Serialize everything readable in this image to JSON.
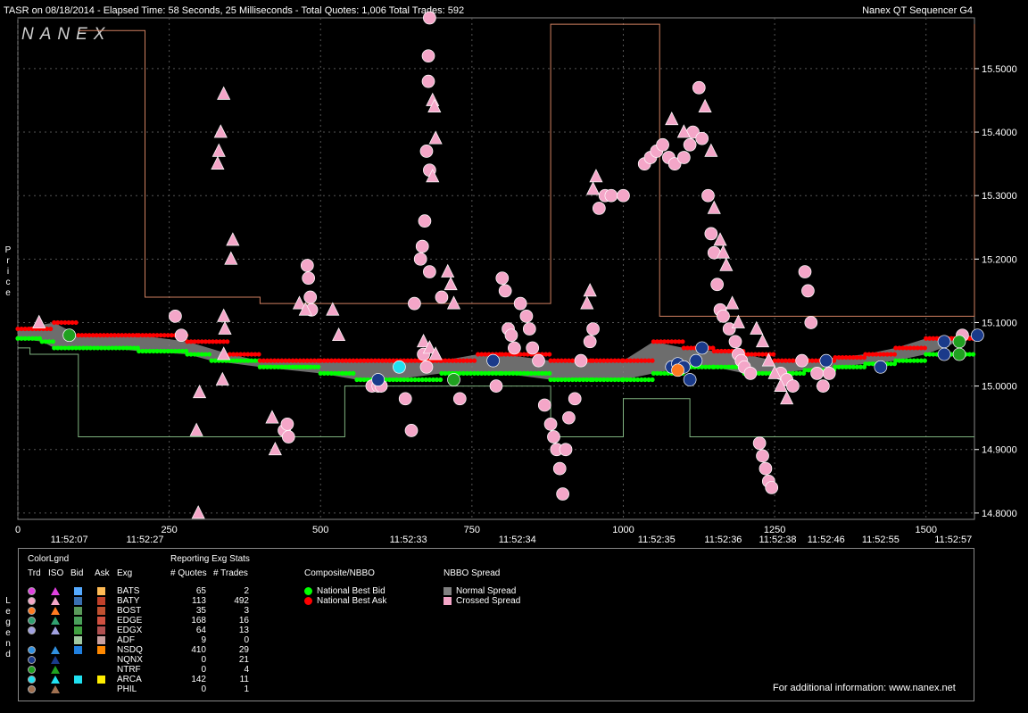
{
  "header": {
    "title": "TASR on 08/18/2014  -  Elapsed Time: 58 Seconds, 25 Milliseconds  -  Total Quotes: 1,006  Total Trades: 592",
    "app_name": "Nanex QT Sequencer G4"
  },
  "watermark": "NANEX",
  "side_labels": {
    "price": [
      "P",
      "r",
      "i",
      "c",
      "e"
    ],
    "legend": [
      "L",
      "e",
      "g",
      "e",
      "n",
      "d"
    ]
  },
  "chart_data": {
    "type": "scatter",
    "title": "TASR on 08/18/2014",
    "xlabel": "",
    "ylabel": "Price",
    "xlim": [
      0,
      1580
    ],
    "ylim": [
      14.79,
      15.58
    ],
    "x_ticks": [
      0,
      250,
      500,
      750,
      1000,
      1250,
      1500
    ],
    "y_ticks": [
      14.8,
      14.9,
      15.0,
      15.1,
      15.2,
      15.3,
      15.4,
      15.5
    ],
    "y_tick_labels": [
      "14.8000",
      "14.9000",
      "15.0000",
      "15.1000",
      "15.2000",
      "15.3000",
      "15.4000",
      "15.5000"
    ],
    "time_labels": [
      {
        "x": 85,
        "label": "11:52:07"
      },
      {
        "x": 210,
        "label": "11:52:27"
      },
      {
        "x": 645,
        "label": "11:52:33"
      },
      {
        "x": 825,
        "label": "11:52:34"
      },
      {
        "x": 1055,
        "label": "11:52:35"
      },
      {
        "x": 1165,
        "label": "11:52:36"
      },
      {
        "x": 1255,
        "label": "11:52:38"
      },
      {
        "x": 1335,
        "label": "11:52:46"
      },
      {
        "x": 1425,
        "label": "11:52:55"
      },
      {
        "x": 1545,
        "label": "11:52:57"
      }
    ],
    "grid": true,
    "nbbo_bid": [
      [
        0,
        15.075
      ],
      [
        40,
        15.07
      ],
      [
        60,
        15.06
      ],
      [
        150,
        15.06
      ],
      [
        200,
        15.055
      ],
      [
        280,
        15.05
      ],
      [
        320,
        15.04
      ],
      [
        400,
        15.03
      ],
      [
        500,
        15.02
      ],
      [
        560,
        15.01
      ],
      [
        620,
        15.01
      ],
      [
        700,
        15.02
      ],
      [
        760,
        15.02
      ],
      [
        800,
        15.02
      ],
      [
        880,
        15.01
      ],
      [
        950,
        15.01
      ],
      [
        1000,
        15.01
      ],
      [
        1050,
        15.02
      ],
      [
        1100,
        15.03
      ],
      [
        1150,
        15.03
      ],
      [
        1200,
        15.02
      ],
      [
        1250,
        15.02
      ],
      [
        1300,
        15.025
      ],
      [
        1350,
        15.03
      ],
      [
        1400,
        15.035
      ],
      [
        1450,
        15.04
      ],
      [
        1500,
        15.05
      ],
      [
        1580,
        15.05
      ]
    ],
    "nbbo_ask": [
      [
        0,
        15.09
      ],
      [
        60,
        15.1
      ],
      [
        100,
        15.08
      ],
      [
        200,
        15.08
      ],
      [
        280,
        15.07
      ],
      [
        350,
        15.05
      ],
      [
        400,
        15.04
      ],
      [
        500,
        15.04
      ],
      [
        560,
        15.04
      ],
      [
        620,
        15.04
      ],
      [
        700,
        15.04
      ],
      [
        760,
        15.05
      ],
      [
        800,
        15.05
      ],
      [
        880,
        15.04
      ],
      [
        950,
        15.04
      ],
      [
        1000,
        15.04
      ],
      [
        1050,
        15.07
      ],
      [
        1100,
        15.06
      ],
      [
        1150,
        15.055
      ],
      [
        1200,
        15.05
      ],
      [
        1250,
        15.04
      ],
      [
        1300,
        15.04
      ],
      [
        1350,
        15.045
      ],
      [
        1400,
        15.05
      ],
      [
        1450,
        15.06
      ],
      [
        1500,
        15.075
      ],
      [
        1580,
        15.08
      ]
    ],
    "trades_pink_circles": [
      [
        85,
        15.08
      ],
      [
        260,
        15.11
      ],
      [
        270,
        15.08
      ],
      [
        478,
        15.19
      ],
      [
        480,
        15.17
      ],
      [
        483,
        15.14
      ],
      [
        485,
        15.12
      ],
      [
        440,
        14.93
      ],
      [
        445,
        14.94
      ],
      [
        447,
        14.92
      ],
      [
        585,
        15.0
      ],
      [
        595,
        15.0
      ],
      [
        600,
        15.0
      ],
      [
        640,
        14.98
      ],
      [
        650,
        14.93
      ],
      [
        655,
        15.13
      ],
      [
        680,
        15.58
      ],
      [
        678,
        15.52
      ],
      [
        678,
        15.48
      ],
      [
        675,
        15.37
      ],
      [
        680,
        15.34
      ],
      [
        672,
        15.26
      ],
      [
        668,
        15.22
      ],
      [
        665,
        15.2
      ],
      [
        680,
        15.18
      ],
      [
        670,
        15.05
      ],
      [
        675,
        15.03
      ],
      [
        700,
        15.14
      ],
      [
        730,
        14.98
      ],
      [
        790,
        15.0
      ],
      [
        800,
        15.17
      ],
      [
        805,
        15.15
      ],
      [
        810,
        15.09
      ],
      [
        815,
        15.08
      ],
      [
        820,
        15.06
      ],
      [
        830,
        15.13
      ],
      [
        840,
        15.11
      ],
      [
        845,
        15.09
      ],
      [
        850,
        15.06
      ],
      [
        860,
        15.04
      ],
      [
        870,
        14.97
      ],
      [
        880,
        14.94
      ],
      [
        885,
        14.92
      ],
      [
        890,
        14.9
      ],
      [
        895,
        14.87
      ],
      [
        900,
        14.83
      ],
      [
        905,
        14.9
      ],
      [
        910,
        14.95
      ],
      [
        920,
        14.98
      ],
      [
        930,
        15.04
      ],
      [
        945,
        15.07
      ],
      [
        950,
        15.09
      ],
      [
        960,
        15.28
      ],
      [
        970,
        15.3
      ],
      [
        980,
        15.3
      ],
      [
        1000,
        15.3
      ],
      [
        1035,
        15.35
      ],
      [
        1045,
        15.36
      ],
      [
        1055,
        15.37
      ],
      [
        1065,
        15.38
      ],
      [
        1075,
        15.36
      ],
      [
        1085,
        15.35
      ],
      [
        1100,
        15.36
      ],
      [
        1110,
        15.38
      ],
      [
        1115,
        15.4
      ],
      [
        1125,
        15.47
      ],
      [
        1130,
        15.39
      ],
      [
        1140,
        15.3
      ],
      [
        1145,
        15.24
      ],
      [
        1150,
        15.21
      ],
      [
        1155,
        15.16
      ],
      [
        1160,
        15.12
      ],
      [
        1165,
        15.11
      ],
      [
        1175,
        15.09
      ],
      [
        1185,
        15.07
      ],
      [
        1190,
        15.05
      ],
      [
        1195,
        15.04
      ],
      [
        1200,
        15.03
      ],
      [
        1210,
        15.02
      ],
      [
        1225,
        14.91
      ],
      [
        1230,
        14.89
      ],
      [
        1235,
        14.87
      ],
      [
        1240,
        14.85
      ],
      [
        1245,
        14.84
      ],
      [
        1260,
        15.02
      ],
      [
        1270,
        15.01
      ],
      [
        1280,
        15.0
      ],
      [
        1295,
        15.04
      ],
      [
        1300,
        15.18
      ],
      [
        1305,
        15.15
      ],
      [
        1310,
        15.1
      ],
      [
        1320,
        15.02
      ],
      [
        1330,
        15.0
      ],
      [
        1340,
        15.02
      ],
      [
        1560,
        15.08
      ]
    ],
    "trades_pink_triangles": [
      [
        35,
        15.1
      ],
      [
        340,
        15.46
      ],
      [
        335,
        15.4
      ],
      [
        332,
        15.37
      ],
      [
        330,
        15.35
      ],
      [
        355,
        15.23
      ],
      [
        352,
        15.2
      ],
      [
        340,
        15.11
      ],
      [
        342,
        15.09
      ],
      [
        340,
        15.05
      ],
      [
        338,
        15.01
      ],
      [
        300,
        14.99
      ],
      [
        295,
        14.93
      ],
      [
        298,
        14.8
      ],
      [
        420,
        14.95
      ],
      [
        425,
        14.9
      ],
      [
        465,
        15.13
      ],
      [
        475,
        15.12
      ],
      [
        520,
        15.12
      ],
      [
        530,
        15.08
      ],
      [
        670,
        15.07
      ],
      [
        680,
        15.06
      ],
      [
        690,
        15.05
      ],
      [
        710,
        15.18
      ],
      [
        715,
        15.16
      ],
      [
        720,
        15.13
      ],
      [
        685,
        15.45
      ],
      [
        688,
        15.44
      ],
      [
        690,
        15.39
      ],
      [
        685,
        15.33
      ],
      [
        955,
        15.33
      ],
      [
        950,
        15.31
      ],
      [
        945,
        15.15
      ],
      [
        940,
        15.13
      ],
      [
        1080,
        15.42
      ],
      [
        1100,
        15.4
      ],
      [
        1135,
        15.44
      ],
      [
        1145,
        15.37
      ],
      [
        1150,
        15.28
      ],
      [
        1160,
        15.23
      ],
      [
        1165,
        15.21
      ],
      [
        1170,
        15.19
      ],
      [
        1180,
        15.13
      ],
      [
        1190,
        15.1
      ],
      [
        1220,
        15.09
      ],
      [
        1230,
        15.07
      ],
      [
        1240,
        15.04
      ],
      [
        1250,
        15.02
      ],
      [
        1260,
        15.0
      ],
      [
        1270,
        14.98
      ]
    ],
    "trades_blue_circles": [
      [
        595,
        15.01
      ],
      [
        785,
        15.04
      ],
      [
        1080,
        15.03
      ],
      [
        1090,
        15.035
      ],
      [
        1100,
        15.03
      ],
      [
        1110,
        15.01
      ],
      [
        1120,
        15.04
      ],
      [
        1130,
        15.06
      ],
      [
        1335,
        15.04
      ],
      [
        1425,
        15.03
      ],
      [
        1530,
        15.07
      ],
      [
        1530,
        15.05
      ],
      [
        1585,
        15.08
      ]
    ],
    "trades_green_circles": [
      [
        85,
        15.08
      ],
      [
        720,
        15.01
      ],
      [
        1555,
        15.07
      ],
      [
        1555,
        15.05
      ]
    ],
    "trades_cyan_circles": [
      [
        630,
        15.03
      ]
    ],
    "trades_orange_circles": [
      [
        1090,
        15.025
      ]
    ],
    "quote_lines_bid": [
      [
        0,
        15.06
      ],
      [
        20,
        15.06
      ],
      [
        20,
        15.05
      ],
      [
        100,
        15.05
      ],
      [
        100,
        14.92
      ],
      [
        540,
        14.92
      ],
      [
        540,
        15.0
      ],
      [
        880,
        15.0
      ],
      [
        880,
        14.92
      ],
      [
        1000,
        14.92
      ],
      [
        1000,
        14.98
      ],
      [
        1110,
        14.98
      ],
      [
        1110,
        14.92
      ],
      [
        1580,
        14.92
      ]
    ],
    "quote_lines_ask_high": [
      [
        100,
        15.56
      ],
      [
        210,
        15.56
      ],
      [
        210,
        15.14
      ],
      [
        400,
        15.14
      ],
      [
        400,
        15.13
      ],
      [
        880,
        15.13
      ],
      [
        880,
        15.57
      ],
      [
        1060,
        15.57
      ],
      [
        1060,
        15.11
      ],
      [
        1580,
        15.11
      ],
      [
        1580,
        15.57
      ]
    ]
  },
  "legend": {
    "header_colorlgnd": "ColorLgnd",
    "col_trd": "Trd",
    "col_iso": "ISO",
    "col_bid": "Bid",
    "col_ask": "Ask",
    "col_exg": "Exg",
    "header_reporting": "Reporting Exg Stats",
    "col_quotes": "# Quotes",
    "col_trades": "# Trades",
    "rows": [
      {
        "exg": "BATS",
        "quotes": "65",
        "trades": "2",
        "trd": "#e040e0",
        "iso": "#e040e0",
        "bid": "#55aaff",
        "ask": "#ffbb55"
      },
      {
        "exg": "BATY",
        "quotes": "113",
        "trades": "492",
        "trd": "#f4a6c8",
        "iso": "#f4a6c8",
        "bid": "#3a6fb0",
        "ask": "#c0402a"
      },
      {
        "exg": "BOST",
        "quotes": "35",
        "trades": "3",
        "trd": "#ff7a20",
        "iso": "#ff7a20",
        "bid": "#5a9a5a",
        "ask": "#c05030"
      },
      {
        "exg": "EDGE",
        "quotes": "168",
        "trades": "16",
        "trd": "#30a070",
        "iso": "#30a070",
        "bid": "#4aa05a",
        "ask": "#d05040"
      },
      {
        "exg": "EDGX",
        "quotes": "64",
        "trades": "13",
        "trd": "#a0a0e0",
        "iso": "#a0a0e0",
        "bid": "#40a040",
        "ask": "#b05050"
      },
      {
        "exg": "ADF",
        "quotes": "9",
        "trades": "0",
        "trd": "",
        "iso": "",
        "bid": "#a0c8a0",
        "ask": "#c8a0a0"
      },
      {
        "exg": "NSDQ",
        "quotes": "410",
        "trades": "29",
        "trd": "#3090e0",
        "iso": "#3090e0",
        "bid": "#2080e0",
        "ask": "#ff8800"
      },
      {
        "exg": "NQNX",
        "quotes": "0",
        "trades": "21",
        "trd": "#1a3a8a",
        "iso": "#1a3a8a",
        "bid": "",
        "ask": ""
      },
      {
        "exg": "NTRF",
        "quotes": "0",
        "trades": "4",
        "trd": "#20a020",
        "iso": "#20a020",
        "bid": "",
        "ask": ""
      },
      {
        "exg": "ARCA",
        "quotes": "142",
        "trades": "11",
        "trd": "#20e0f0",
        "iso": "#20e0f0",
        "bid": "#20e0f0",
        "ask": "#ffee00"
      },
      {
        "exg": "PHIL",
        "quotes": "0",
        "trades": "1",
        "trd": "#a07050",
        "iso": "#a07050",
        "bid": "",
        "ask": ""
      }
    ],
    "composite_header": "Composite/NBBO",
    "national_best_bid": "National Best Bid",
    "national_best_ask": "National Best Ask",
    "spread_header": "NBBO Spread",
    "normal_spread": "Normal Spread",
    "crossed_spread": "Crossed Spread",
    "footer_info": "For additional information: www.nanex.net",
    "colors": {
      "nbb": "#00ff00",
      "nba": "#ff0000",
      "normal_spread": "#808080",
      "crossed_spread": "#f4a6c8"
    }
  }
}
